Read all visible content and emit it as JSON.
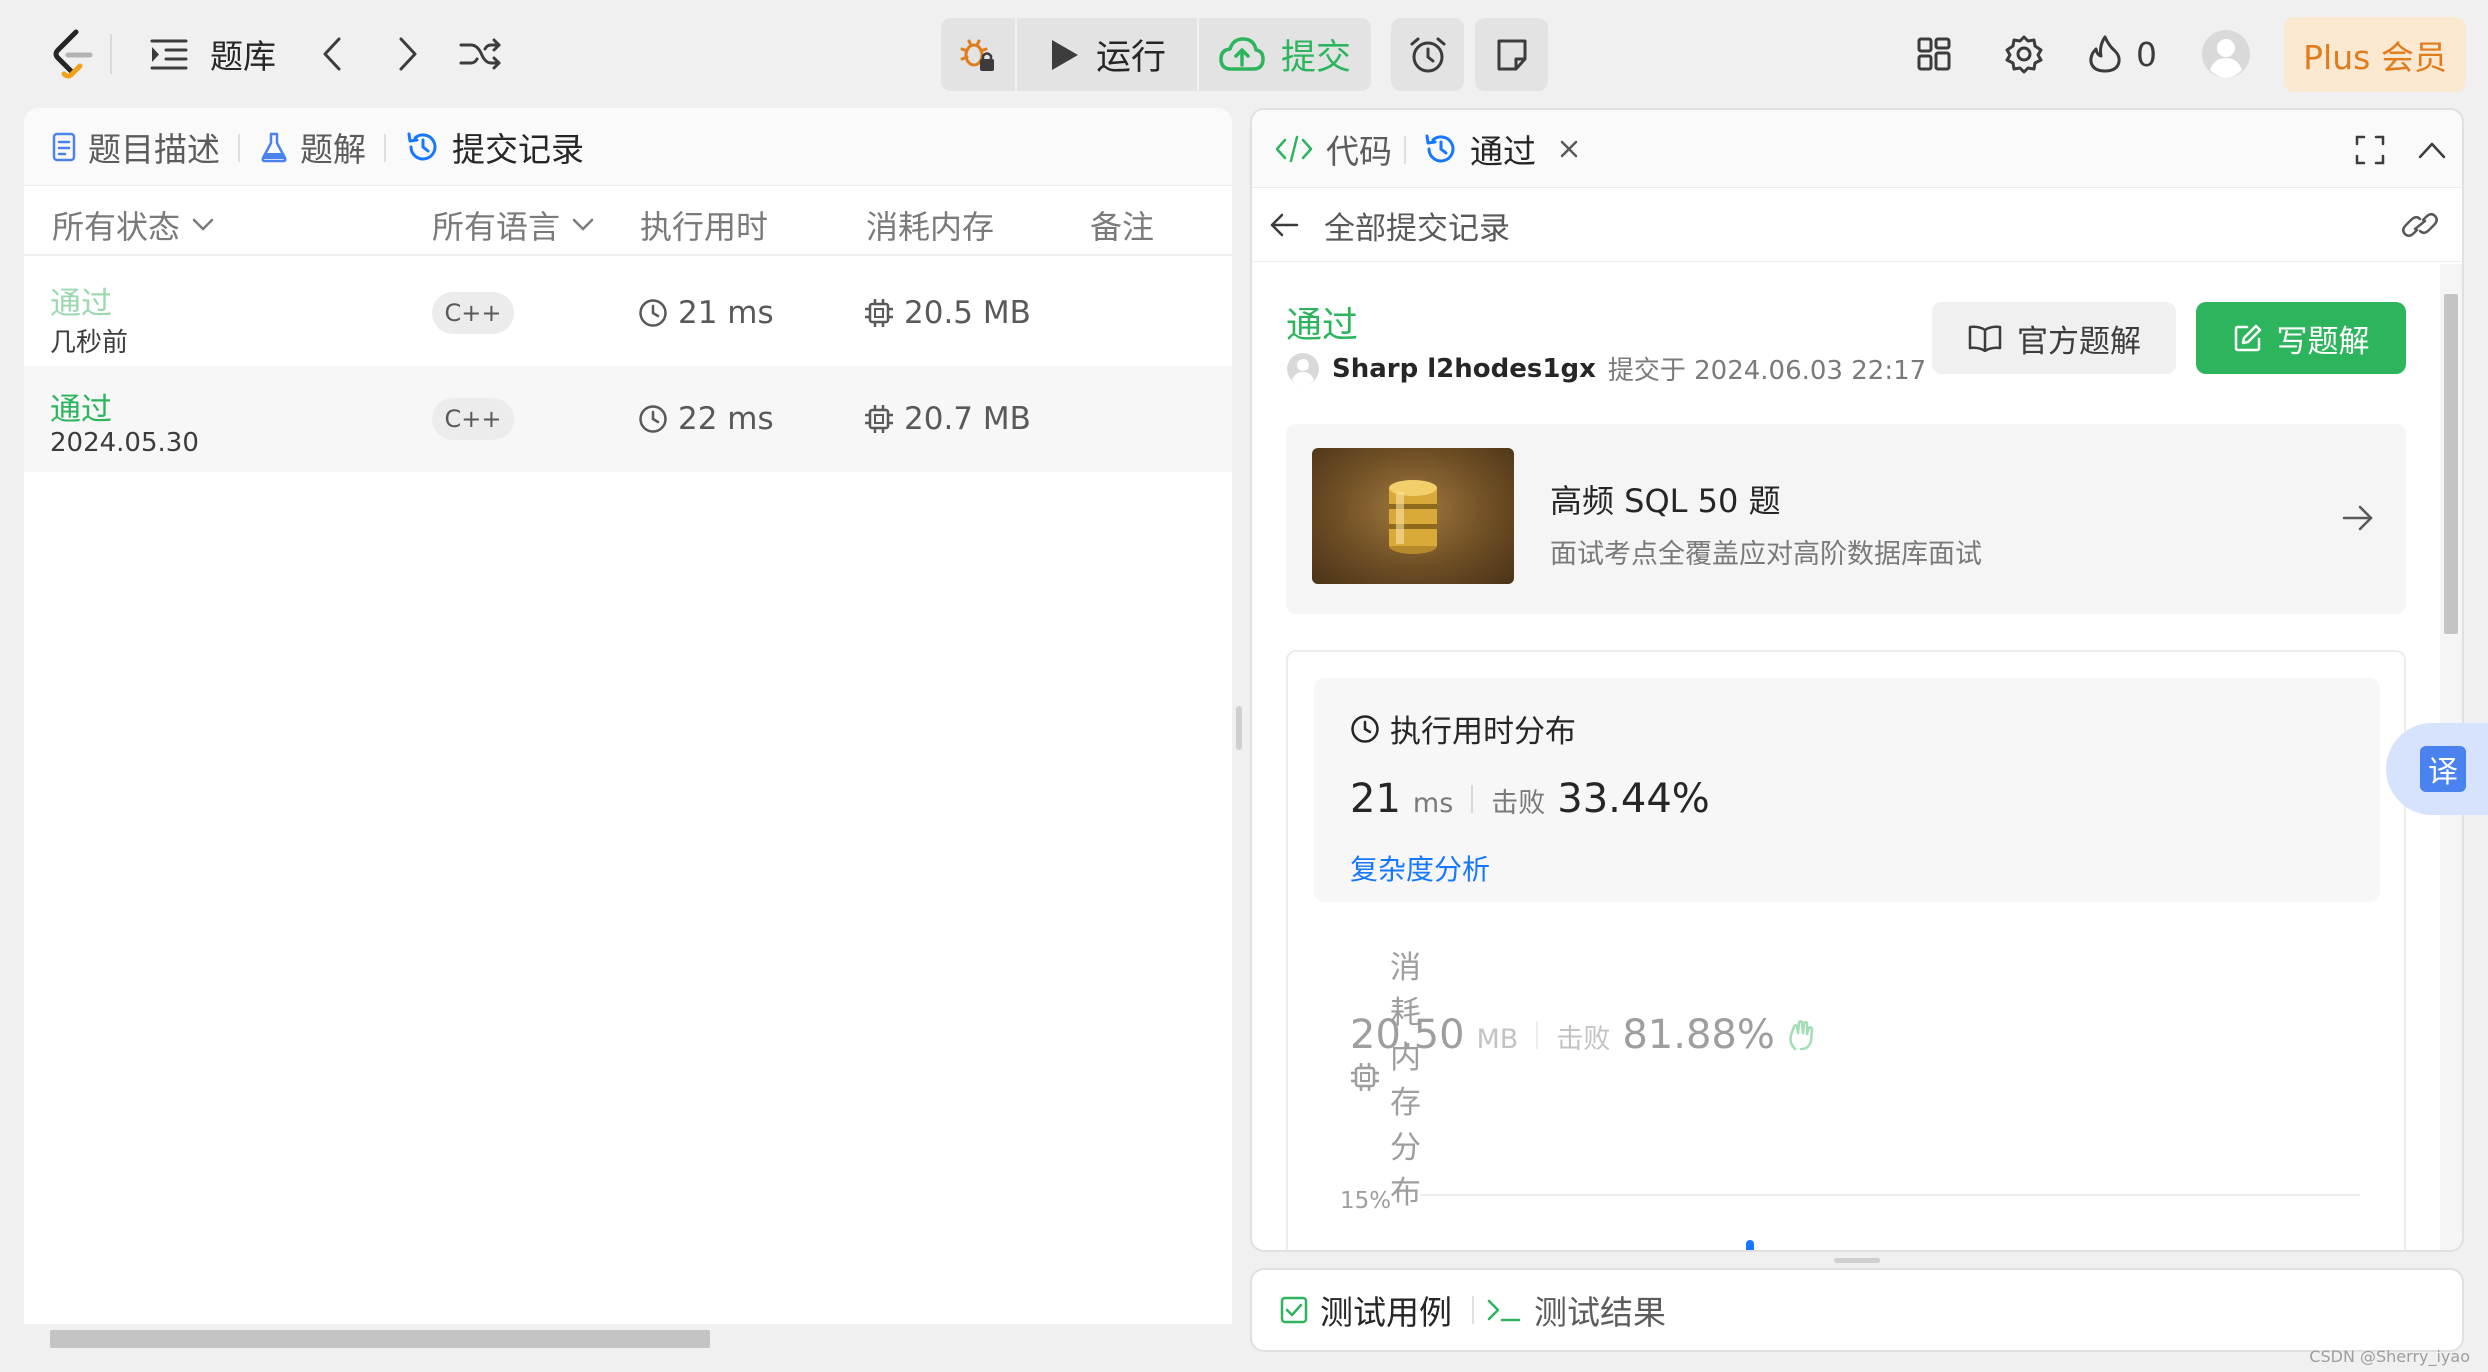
{
  "topbar": {
    "problemset_label": "题库",
    "run_label": "运行",
    "submit_label": "提交",
    "streak_count": "0",
    "plus_label": "Plus 会员"
  },
  "left_panel": {
    "tabs": [
      {
        "label": "题目描述"
      },
      {
        "label": "题解"
      },
      {
        "label": "提交记录"
      }
    ],
    "columns": {
      "status": "所有状态",
      "language": "所有语言",
      "runtime": "执行用时",
      "memory": "消耗内存",
      "notes": "备注"
    },
    "rows": [
      {
        "status": "通过",
        "time": "几秒前",
        "language": "C++",
        "runtime": "21 ms",
        "memory": "20.5 MB"
      },
      {
        "status": "通过",
        "time": "2024.05.30",
        "language": "C++",
        "runtime": "22 ms",
        "memory": "20.7 MB"
      }
    ]
  },
  "right_panel": {
    "tabs": {
      "code": "代码",
      "result": "通过"
    },
    "back_label": "全部提交记录",
    "result": {
      "status": "通过",
      "user": "Sharp l2hodes1gx",
      "submitted_text": "提交于 2024.06.03 22:17",
      "official_solution_label": "官方题解",
      "write_solution_label": "写题解"
    },
    "promo": {
      "title": "高频 SQL 50 题",
      "subtitle": "面试考点全覆盖应对高阶数据库面试"
    },
    "runtime_dist": {
      "title": "执行用时分布",
      "value": "21",
      "unit": "ms",
      "beats_label": "击败",
      "beats_pct": "33.44%",
      "analysis_link": "复杂度分析"
    },
    "memory_dist": {
      "title": "消耗内存分布",
      "value": "20.50",
      "unit": "MB",
      "beats_label": "击败",
      "beats_pct": "81.88%"
    },
    "chart_axis_label": "15%"
  },
  "bottom_panel": {
    "testcase_label": "测试用例",
    "testresult_label": "测试结果"
  },
  "translate_label": "译",
  "watermark": "CSDN @Sherry_iyao",
  "colors": {
    "accept_green": "#2db55d",
    "link_blue": "#1677ff",
    "plus_orange": "#e07c1c"
  },
  "icons": [
    "leetcode-logo-icon",
    "list-icon",
    "chevron-left-icon",
    "chevron-right-icon",
    "shuffle-icon",
    "debug-icon",
    "play-icon",
    "cloud-upload-icon",
    "alarm-icon",
    "note-icon",
    "layout-icon",
    "gear-icon",
    "fire-icon",
    "avatar-icon",
    "file-icon",
    "flask-icon",
    "history-icon",
    "clock-icon",
    "cpu-icon",
    "code-icon",
    "close-icon",
    "expand-icon",
    "collapse-icon",
    "arrow-left-icon",
    "link-icon",
    "book-icon",
    "edit-icon",
    "arrow-right-icon",
    "checkbox-icon",
    "terminal-icon"
  ]
}
